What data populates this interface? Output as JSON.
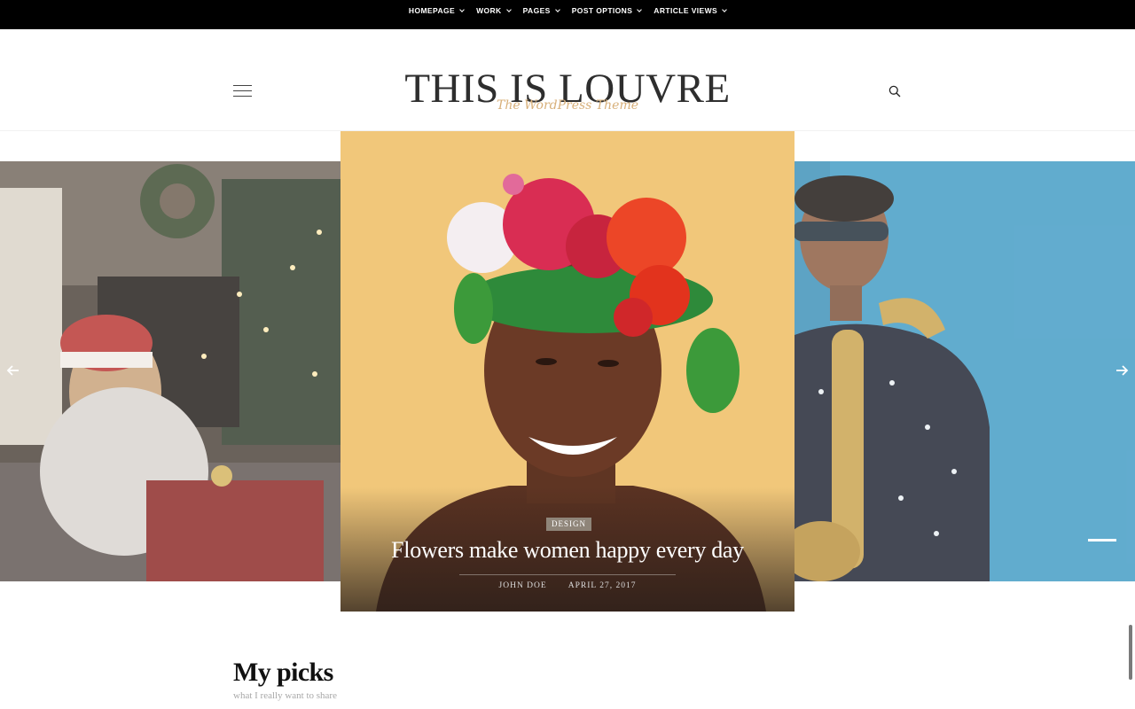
{
  "nav": {
    "items": [
      {
        "label": "HOMEPAGE"
      },
      {
        "label": "WORK"
      },
      {
        "label": "PAGES"
      },
      {
        "label": "POST OPTIONS"
      },
      {
        "label": "ARTICLE VIEWS"
      }
    ]
  },
  "header": {
    "logo_title": "THIS IS LOUVRE",
    "logo_subtitle": "The WordPress Theme"
  },
  "slider": {
    "featured": {
      "category": "DESIGN",
      "title": "Flowers make women happy every day",
      "author": "JOHN DOE",
      "date": "APRIL 27, 2017"
    }
  },
  "section": {
    "title": "My picks",
    "subtitle": "what I really want to share"
  },
  "colors": {
    "topbar_bg": "#000000",
    "logo_gold": "#d8b07a",
    "center_bg": "#f1c77a",
    "right_bg": "#3f9ac4"
  }
}
